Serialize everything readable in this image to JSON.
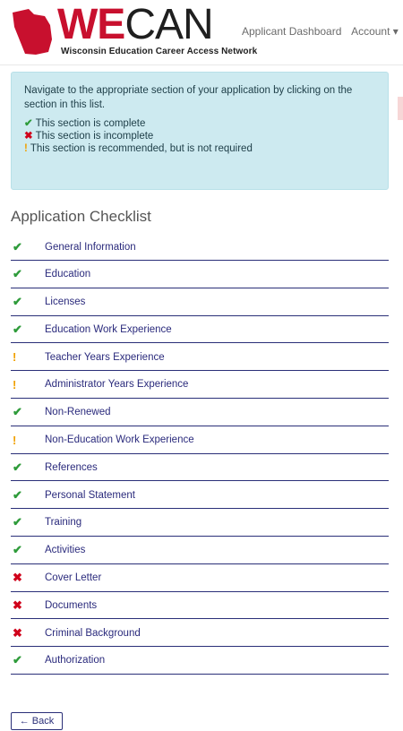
{
  "header": {
    "brand_prefix": "WE",
    "brand_suffix": "CAN",
    "tagline": "Wisconsin Education Career Access Network",
    "nav": [
      "Applicant Dashboard",
      "Account ▾"
    ]
  },
  "info": {
    "intro": "Navigate to the appropriate section of your application by clicking on the section in this list.",
    "legend": [
      {
        "icon": "✔",
        "text": "This section is complete",
        "class": "g"
      },
      {
        "icon": "✖",
        "text": "This section is incomplete",
        "class": "r"
      },
      {
        "icon": "!",
        "text": "This section is recommended, but is not required",
        "class": "o"
      }
    ]
  },
  "checklist": {
    "title": "Application Checklist",
    "items": [
      {
        "label": "General Information",
        "status": "complete"
      },
      {
        "label": "Education",
        "status": "complete"
      },
      {
        "label": "Licenses",
        "status": "complete"
      },
      {
        "label": "Education Work Experience",
        "status": "complete"
      },
      {
        "label": "Teacher Years Experience",
        "status": "recommended"
      },
      {
        "label": "Administrator Years Experience",
        "status": "recommended"
      },
      {
        "label": "Non-Renewed",
        "status": "complete"
      },
      {
        "label": "Non-Education Work Experience",
        "status": "recommended"
      },
      {
        "label": "References",
        "status": "complete"
      },
      {
        "label": "Personal Statement",
        "status": "complete"
      },
      {
        "label": "Training",
        "status": "complete"
      },
      {
        "label": "Activities",
        "status": "complete"
      },
      {
        "label": "Cover Letter",
        "status": "incomplete"
      },
      {
        "label": "Documents",
        "status": "incomplete"
      },
      {
        "label": "Criminal Background",
        "status": "incomplete"
      },
      {
        "label": "Authorization",
        "status": "complete"
      }
    ]
  },
  "back_label": "← Back",
  "colors": {
    "complete": "#2e9b3a",
    "incomplete": "#d0021b",
    "recommended": "#f0a000",
    "brand_red": "#c8102e",
    "link": "#2a2f78"
  }
}
